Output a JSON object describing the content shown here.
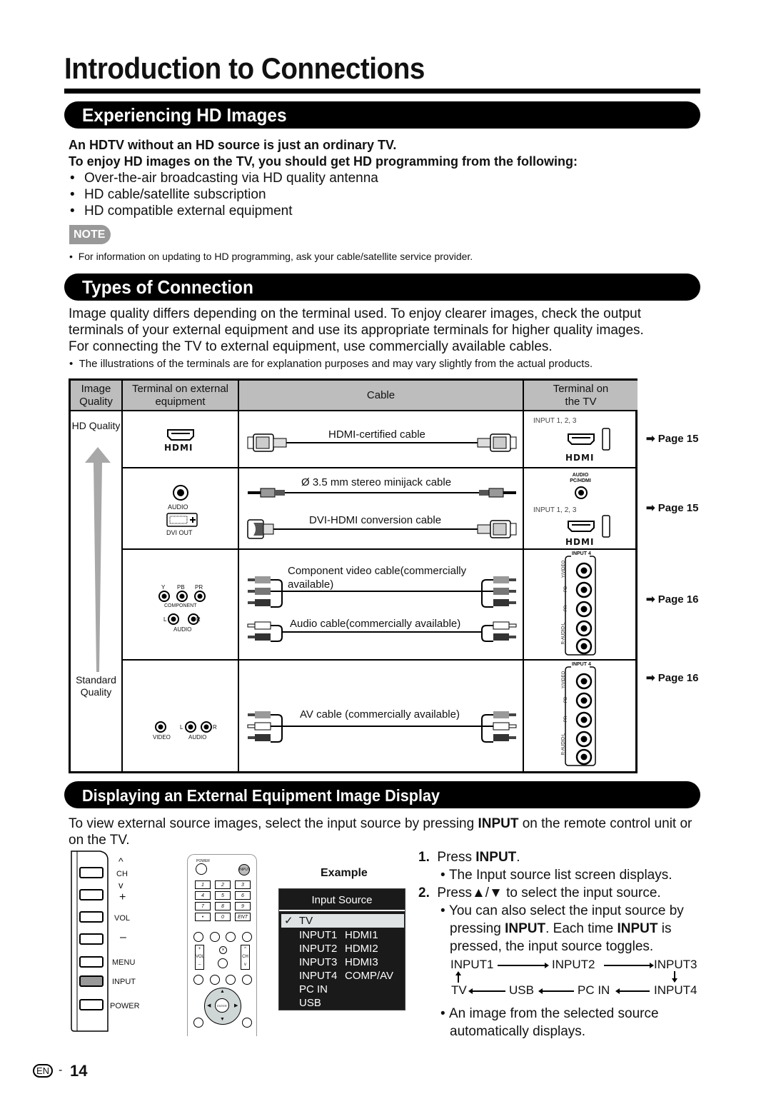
{
  "page": {
    "title": "Introduction to Connections",
    "page_number": "14",
    "language_badge": "EN",
    "page_separator": "-"
  },
  "hd_section": {
    "heading": "Experiencing HD Images",
    "lead1": "An HDTV without an HD source is just an ordinary TV.",
    "lead2": "To enjoy HD images on the TV, you should get HD programming from the following:",
    "bullets": [
      "Over-the-air broadcasting via HD quality antenna",
      "HD cable/satellite subscription",
      "HD compatible external equipment"
    ],
    "note_label": "NOTE",
    "note": "For information on updating to HD programming, ask your cable/satellite service provider."
  },
  "types_section": {
    "heading": "Types of Connection",
    "para1": "Image quality differs depending on the terminal used. To enjoy clearer images, check the output terminals of your external equipment and use its appropriate terminals for higher quality images.",
    "para2": "For connecting the TV to external equipment, use commercially available cables.",
    "note": "The illustrations of the terminals are for explanation purposes and may vary slightly from the actual products.",
    "table": {
      "headers": {
        "quality": "Image Quality",
        "terminal_ext": "Terminal on external equipment",
        "cable": "Cable",
        "terminal_tv": "Terminal on the TV"
      },
      "quality_top": "HD Quality",
      "quality_bottom": "Standard Quality",
      "rows": [
        {
          "ext_labels": [
            "HDMI"
          ],
          "cables": [
            "HDMI-certified cable"
          ],
          "tv_labels": [
            "INPUT 1, 2, 3",
            "HDMI"
          ],
          "page_ref": "Page 15"
        },
        {
          "ext_labels": [
            "AUDIO",
            "DVI OUT"
          ],
          "cables": [
            "Ø 3.5 mm stereo minijack cable",
            "DVI-HDMI conversion cable"
          ],
          "tv_labels": [
            "AUDIO PC/HDMI",
            "INPUT 1, 2, 3",
            "HDMI"
          ],
          "page_ref": "Page 15"
        },
        {
          "ext_labels": [
            "Y",
            "PB",
            "PR",
            "COMPONENT",
            "L",
            "R",
            "AUDIO"
          ],
          "cables": [
            "Component video cable(commercially available)",
            "Audio cable(commercially available)"
          ],
          "tv_labels": [
            "INPUT 4",
            "Y/VIDEO",
            "PB",
            "PR",
            "R-AUDIO-L"
          ],
          "page_ref": "Page 16"
        },
        {
          "ext_labels": [
            "VIDEO",
            "L",
            "R",
            "AUDIO"
          ],
          "cables": [
            "AV cable (commercially available)"
          ],
          "tv_labels": [
            "INPUT 4",
            "Y/VIDEO",
            "PB",
            "PR",
            "R-AUDIO-L"
          ],
          "page_ref": "Page 16"
        }
      ]
    }
  },
  "display_section": {
    "heading": "Displaying an External Equipment Image Display",
    "intro_before": "To view external source images, select the input source by pressing ",
    "intro_bold": "INPUT",
    "intro_after": " on the remote control unit or on the TV.",
    "tv_panel_buttons": [
      "CH",
      "VOL",
      "MENU",
      "INPUT",
      "POWER"
    ],
    "tv_panel_symbols": {
      "ch_up": "^",
      "ch_down": "v",
      "vol_up": "+",
      "vol_down": "–"
    },
    "remote": {
      "power": "POWER",
      "input": "INPUT",
      "keys": [
        "1",
        "2",
        "3",
        "4",
        "5",
        "6",
        "7",
        "8",
        "9",
        "•",
        "0",
        "ENT"
      ],
      "fn_row1": [
        "DISPLAY",
        "FREEZE",
        "AUDIO",
        "FLASHBACK"
      ],
      "vol": "VOL",
      "ch": "CH",
      "mute": "MUTE",
      "surround": "SURROUND",
      "fn_row2": [
        "TV",
        "USB",
        "PC",
        "MENU"
      ],
      "enter": "ENTER",
      "exit": "EXIT",
      "return": "RETURN"
    },
    "example_label": "Example",
    "input_source": {
      "title": "Input Source",
      "selected": "TV",
      "items": [
        [
          "INPUT1",
          "HDMI1"
        ],
        [
          "INPUT2",
          "HDMI2"
        ],
        [
          "INPUT3",
          "HDMI3"
        ],
        [
          "INPUT4",
          "COMP/AV"
        ],
        [
          "PC IN",
          ""
        ],
        [
          "USB",
          ""
        ]
      ]
    },
    "steps": {
      "s1_num": "1.",
      "s1_pre": "Press ",
      "s1_bold": "INPUT",
      "s1_post": ".",
      "s1_sub": "The Input source list screen displays.",
      "s2_num": "2.",
      "s2_text": "Press▲/▼ to select the input source.",
      "s2_sub_a1": "You can also select the input source by",
      "s2_sub_a2_pre": "pressing ",
      "s2_sub_a2_bold1": "INPUT",
      "s2_sub_a2_mid": ". Each time ",
      "s2_sub_a2_bold2": "INPUT",
      "s2_sub_a2_post": " is",
      "s2_sub_a3": "pressed, the input source toggles.",
      "final1": "An image from the selected source",
      "final2": "automatically displays."
    },
    "toggle_cycle": {
      "top": [
        "INPUT1",
        "INPUT2",
        "INPUT3"
      ],
      "bottom": [
        "TV",
        "USB",
        "PC IN",
        "INPUT4"
      ]
    }
  }
}
